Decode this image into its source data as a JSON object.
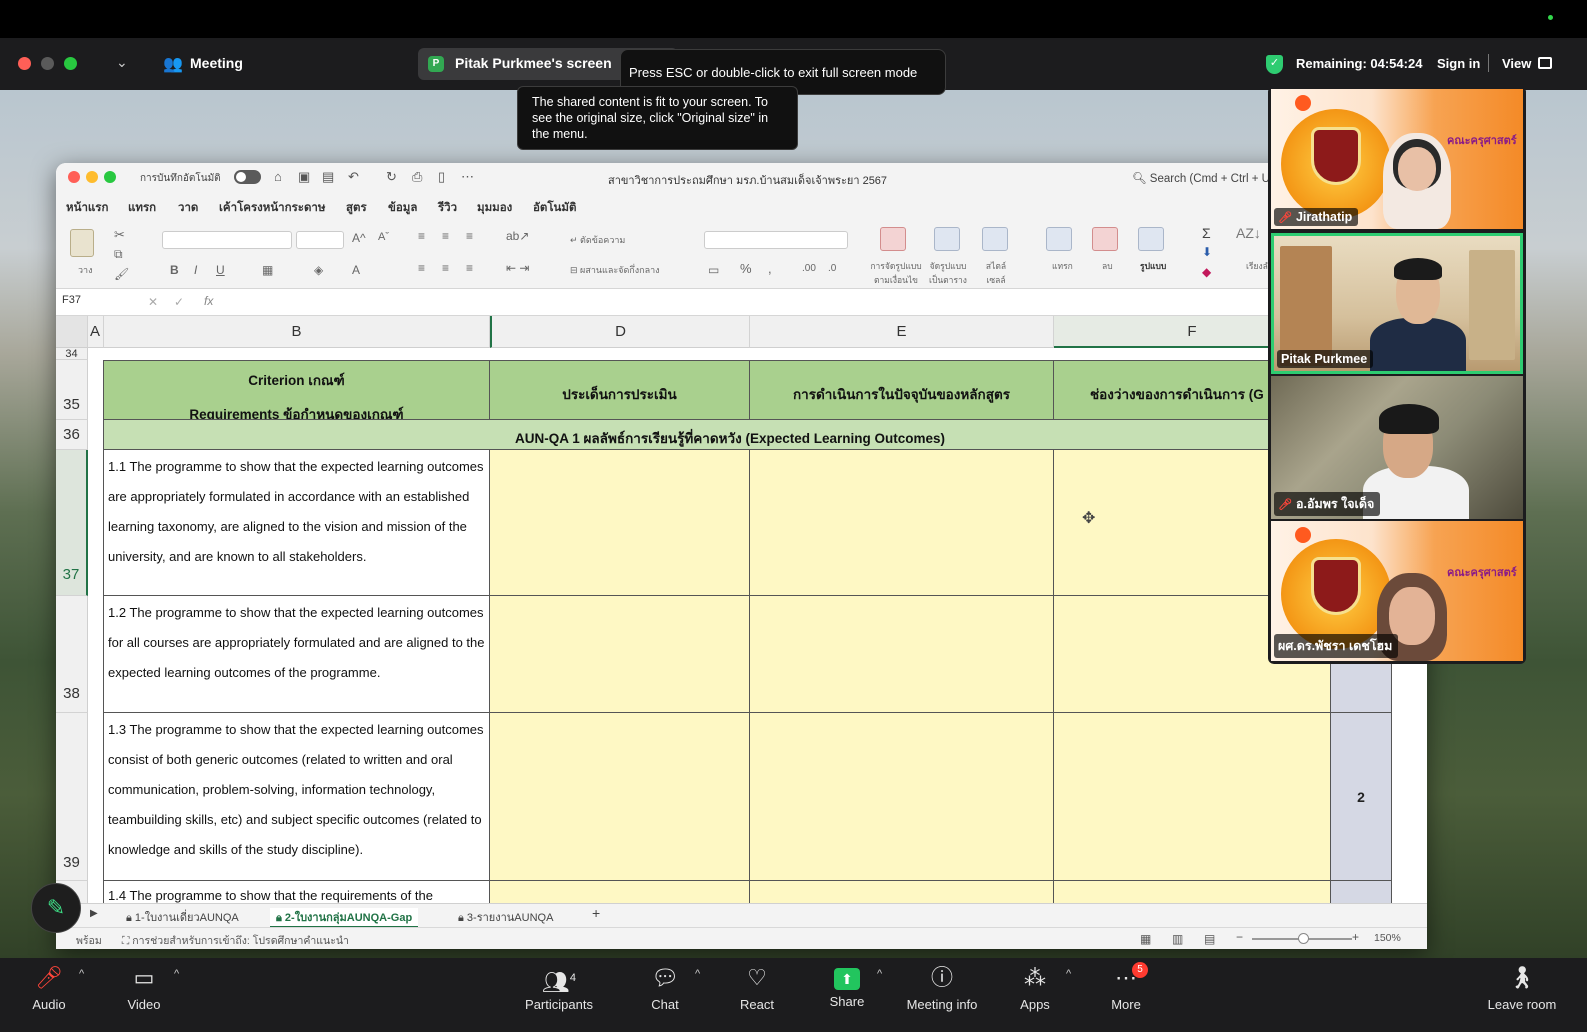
{
  "zoom": {
    "meeting_label": "Meeting",
    "sharer_initial": "P",
    "sharer_screen": "Pitak Purkmee's screen",
    "esc_tip": "Press ESC or double-click to exit full screen mode",
    "fit_tip": "The shared content is fit to your screen. To see the original size, click \"Original size\" in the menu.",
    "remaining": "Remaining: 04:54:24",
    "sign_in": "Sign in",
    "view": "View"
  },
  "excel": {
    "autosave": "การบันทึกอัตโนมัติ",
    "doc_title": "สาขาวิชาการประถมศึกษา มรภ.บ้านสมเด็จเจ้าพระยา 2567",
    "search": "Search (Cmd + Ctrl + U)",
    "tabs": [
      "หน้าแรก",
      "แทรก",
      "วาด",
      "เค้าโครงหน้ากระดาษ",
      "สูตร",
      "ข้อมูล",
      "รีวิว",
      "มุมมอง",
      "อัตโนมัติ"
    ],
    "ribbon": {
      "paste": "วาง",
      "wrap": "ตัดข้อความ",
      "merge": "ผสานและจัดกึ่งกลาง",
      "cond_format": "การจัดรูปแบบ ตามเงื่อนไข",
      "table_format": "จัดรูปแบบ เป็นตาราง",
      "cell_style": "สไตล์ เซลล์",
      "insert": "แทรก",
      "delete": "ลบ",
      "format": "รูปแบบ",
      "sort": "เรียงลำดับ และกรอง"
    },
    "name_box": "F37",
    "fx": "fx",
    "columns": [
      "A",
      "B",
      "D",
      "E",
      "F"
    ],
    "rows": [
      "34",
      "35",
      "36",
      "37",
      "38",
      "39"
    ],
    "header": {
      "criterion_en": "Criterion เกณฑ์",
      "criterion_req": "Requirements ข้อกำหนดของเกณฑ์",
      "d": "ประเด็นการประเมิน",
      "e": "การดำเนินการในปัจจุบันของหลักสูตร",
      "f": "ช่องว่างของการดำเนินการ (G"
    },
    "section": "AUN-QA 1 ผลลัพธ์การเรียนรู้ที่คาดหวัง  (Expected Learning Outcomes)",
    "criteria": [
      "1.1 The programme to show that the expected learning outcomes are appropriately formulated in accordance with an established learning taxonomy, are aligned to the vision and mission of the university, and are known to all stakeholders.",
      "1.2 The programme to show that the expected learning outcomes for all courses are appropriately formulated and are aligned to the expected learning outcomes of the programme.",
      "1.3 The programme to show that the expected learning outcomes consist of both generic outcomes (related to written and oral communication, problem-solving, information technology, teambuilding skills, etc) and subject specific outcomes (related to knowledge and skills of the study discipline).",
      "1.4 The programme to show that the requirements of the"
    ],
    "score_39": "2",
    "sheet_tabs": [
      "1-ใบงานเดี่ยวAUNQA",
      "2-ใบงานกลุ่มAUNQA-Gap",
      "3-รายงานAUNQA"
    ],
    "status_ready": "พร้อม",
    "status_accessibility": "การช่วยสำหรับการเข้าถึง: โปรดศึกษาคำแนะนำ",
    "zoom_level": "150%"
  },
  "participants": [
    {
      "name": "Jirathatip",
      "muted": true
    },
    {
      "name": "Pitak Purkmee",
      "muted": false
    },
    {
      "name": "อ.อัมพร ใจเด็จ",
      "muted": true
    },
    {
      "name": "ผศ.ดร.พัชรา เดชโฮม",
      "muted": false
    }
  ],
  "logo_text": "คณะครุศาสตร์",
  "toolbar": {
    "audio": "Audio",
    "video": "Video",
    "participants": "Participants",
    "participants_count": "4",
    "chat": "Chat",
    "react": "React",
    "share": "Share",
    "meeting_info": "Meeting info",
    "apps": "Apps",
    "more": "More",
    "more_badge": "5",
    "leave": "Leave room"
  },
  "colors": {
    "excel_green": "#217346",
    "header_green": "#a9d08e",
    "cell_yellow": "#fef8c4",
    "zoom_bar": "#1c1c1e"
  }
}
